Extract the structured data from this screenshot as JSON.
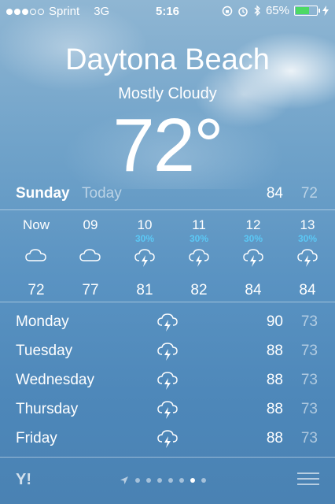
{
  "status_bar": {
    "carrier": "Sprint",
    "network": "3G",
    "time": "5:16",
    "battery_percent": "65%",
    "battery_level": 0.65,
    "battery_color": "#4cd964",
    "signal_bars": 3,
    "signal_total": 5
  },
  "location": {
    "city": "Daytona Beach",
    "condition": "Mostly Cloudy",
    "temperature": "72°"
  },
  "today": {
    "day": "Sunday",
    "label": "Today",
    "high": "84",
    "low": "72"
  },
  "hourly": [
    {
      "time": "Now",
      "pct": "",
      "icon": "cloud-icon",
      "temp": "72"
    },
    {
      "time": "09",
      "pct": "",
      "icon": "cloud-icon",
      "temp": "77"
    },
    {
      "time": "10",
      "pct": "30%",
      "icon": "thunderstorm-icon",
      "temp": "81"
    },
    {
      "time": "11",
      "pct": "30%",
      "icon": "thunderstorm-icon",
      "temp": "82"
    },
    {
      "time": "12",
      "pct": "30%",
      "icon": "thunderstorm-icon",
      "temp": "84"
    },
    {
      "time": "13",
      "pct": "30%",
      "icon": "thunderstorm-icon",
      "temp": "84"
    }
  ],
  "daily": [
    {
      "day": "Monday",
      "icon": "thunderstorm-icon",
      "high": "90",
      "low": "73"
    },
    {
      "day": "Tuesday",
      "icon": "thunderstorm-icon",
      "high": "88",
      "low": "73"
    },
    {
      "day": "Wednesday",
      "icon": "thunderstorm-icon",
      "high": "88",
      "low": "73"
    },
    {
      "day": "Thursday",
      "icon": "thunderstorm-icon",
      "high": "88",
      "low": "73"
    },
    {
      "day": "Friday",
      "icon": "thunderstorm-icon",
      "high": "88",
      "low": "73"
    }
  ],
  "footer": {
    "logo": "Y!",
    "page_count": 7,
    "active_page": 6
  },
  "colors": {
    "precip_accent": "#5bc8f5"
  }
}
